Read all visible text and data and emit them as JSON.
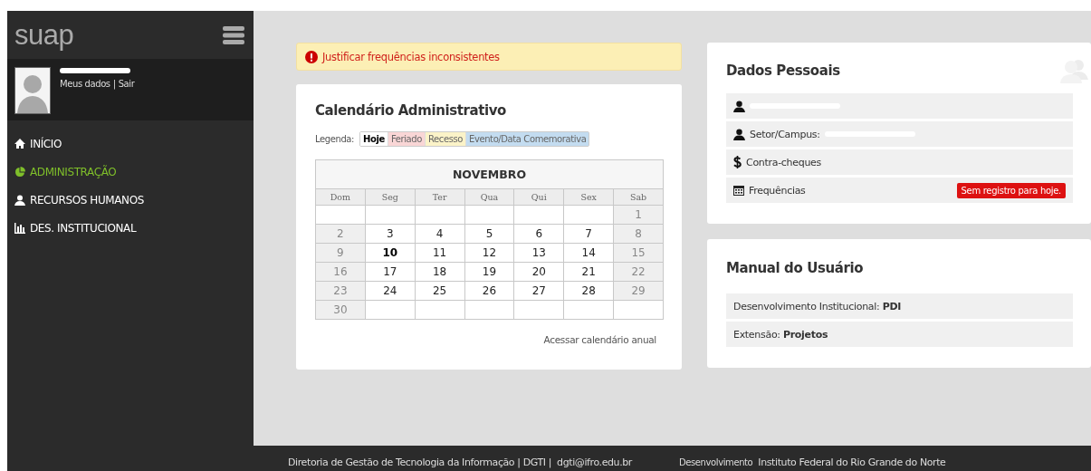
{
  "sidebar": {
    "logo": "suap",
    "profile": {
      "links": [
        "Meus dados",
        "Sair"
      ],
      "separator": "|"
    },
    "items": [
      {
        "label": "INÍCIO",
        "selected": false
      },
      {
        "label": "ADMINISTRAÇÃO",
        "selected": true
      },
      {
        "label": "RECURSOS HUMANOS",
        "selected": false
      },
      {
        "label": "DES. INSTITUCIONAL",
        "selected": false
      }
    ]
  },
  "alert": {
    "text": "Justificar frequências inconsistentes"
  },
  "calendar": {
    "title": "Calendário Administrativo",
    "legend_label": "Legenda:",
    "legend": [
      {
        "label": "Hoje",
        "color": "#ffffff"
      },
      {
        "label": "Feriado",
        "color": "#f9d6d6"
      },
      {
        "label": "Recesso",
        "color": "#fbf3c8"
      },
      {
        "label": "Evento/Data Comemorativa",
        "color": "#c3dcf0"
      }
    ],
    "month": "NOVEMBRO",
    "weekdays": [
      "Dom",
      "Seg",
      "Ter",
      "Qua",
      "Qui",
      "Sex",
      "Sab"
    ],
    "weeks": [
      [
        {
          "kind": "empty"
        },
        {
          "kind": "empty"
        },
        {
          "kind": "empty"
        },
        {
          "kind": "empty"
        },
        {
          "kind": "empty"
        },
        {
          "kind": "empty"
        },
        {
          "day": "1",
          "kind": "weekend"
        }
      ],
      [
        {
          "day": "2",
          "kind": "weekend"
        },
        {
          "day": "3",
          "kind": "weekday"
        },
        {
          "day": "4",
          "kind": "weekday"
        },
        {
          "day": "5",
          "kind": "weekday"
        },
        {
          "day": "6",
          "kind": "weekday"
        },
        {
          "day": "7",
          "kind": "weekday"
        },
        {
          "day": "8",
          "kind": "weekend"
        }
      ],
      [
        {
          "day": "9",
          "kind": "weekend"
        },
        {
          "day": "10",
          "kind": "today"
        },
        {
          "day": "11",
          "kind": "weekday"
        },
        {
          "day": "12",
          "kind": "weekday"
        },
        {
          "day": "13",
          "kind": "weekday"
        },
        {
          "day": "14",
          "kind": "weekday"
        },
        {
          "day": "15",
          "kind": "weekend"
        }
      ],
      [
        {
          "day": "16",
          "kind": "weekend"
        },
        {
          "day": "17",
          "kind": "weekday"
        },
        {
          "day": "18",
          "kind": "weekday"
        },
        {
          "day": "19",
          "kind": "weekday"
        },
        {
          "day": "20",
          "kind": "weekday"
        },
        {
          "day": "21",
          "kind": "weekday"
        },
        {
          "day": "22",
          "kind": "weekend"
        }
      ],
      [
        {
          "day": "23",
          "kind": "weekend"
        },
        {
          "day": "24",
          "kind": "weekday"
        },
        {
          "day": "25",
          "kind": "weekday"
        },
        {
          "day": "26",
          "kind": "weekday"
        },
        {
          "day": "27",
          "kind": "weekday"
        },
        {
          "day": "28",
          "kind": "weekday"
        },
        {
          "day": "29",
          "kind": "weekend"
        }
      ],
      [
        {
          "day": "30",
          "kind": "weekend"
        },
        {
          "kind": "empty"
        },
        {
          "kind": "empty"
        },
        {
          "kind": "empty"
        },
        {
          "kind": "empty"
        },
        {
          "kind": "empty"
        },
        {
          "kind": "empty"
        }
      ]
    ],
    "link": "Acessar calendário anual"
  },
  "personal": {
    "title": "Dados Pessoais",
    "items": [
      {
        "redacted": true
      },
      {
        "label": "Setor/Campus:",
        "redacted": true
      },
      {
        "label": "Contra-cheques",
        "redacted": false
      },
      {
        "label": "Frequências",
        "redacted": false,
        "badge": "Sem registro para hoje."
      }
    ]
  },
  "manual": {
    "title": "Manual do Usuário",
    "items": [
      "Desenvolvimento Institucional: **PDI**",
      "Extensão: **Projetos**"
    ]
  },
  "footer": {
    "left": "Diretoria de Gestão de Tecnologia da Informação | DGTI |",
    "email": "dgti@ifro.edu.br",
    "dev_label": "Desenvolvimento",
    "dev": "Instituto Federal do Rio Grande do Norte"
  }
}
